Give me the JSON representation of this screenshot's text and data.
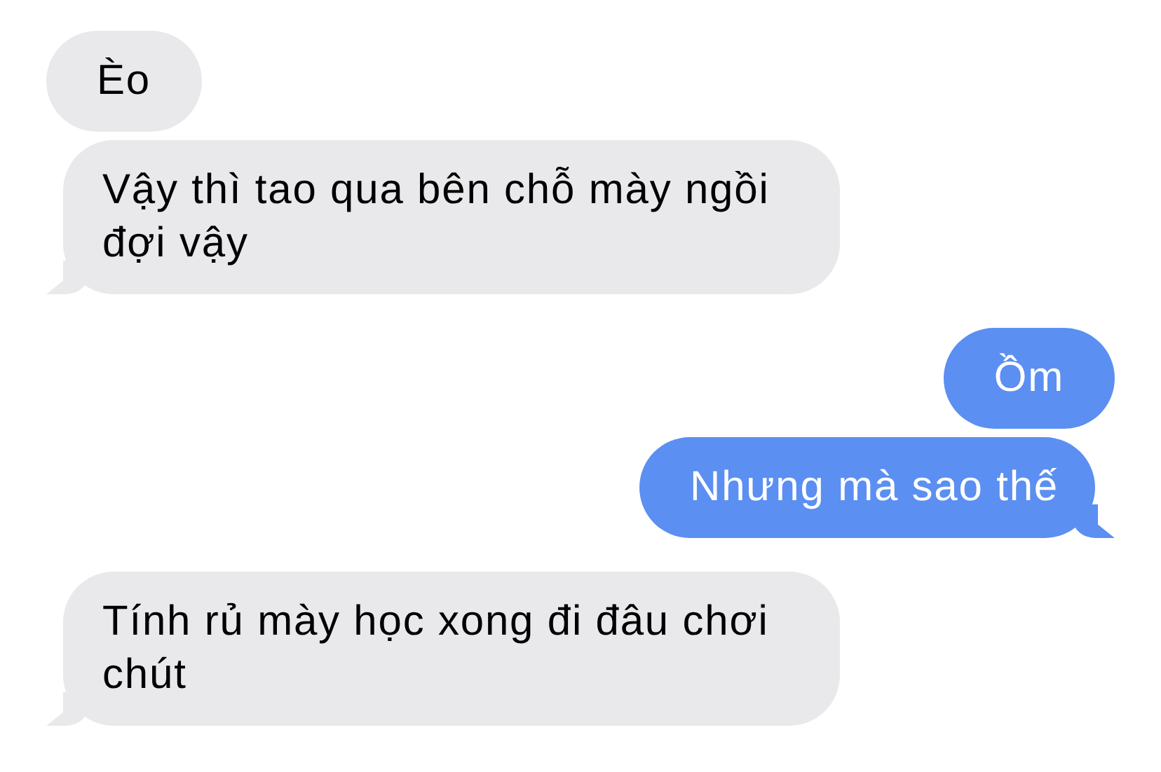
{
  "messages": [
    {
      "text": "Èo",
      "kind": "received",
      "tail": false
    },
    {
      "text": "Vậy thì tao qua bên chỗ mày ngồi đợi vậy",
      "kind": "received",
      "tail": true
    },
    {
      "text": "Ồm",
      "kind": "sent",
      "tail": false
    },
    {
      "text": "Nhưng mà sao thế",
      "kind": "sent",
      "tail": true
    },
    {
      "text": "Tính rủ mày học xong đi đâu chơi chút",
      "kind": "received",
      "tail": true
    }
  ]
}
